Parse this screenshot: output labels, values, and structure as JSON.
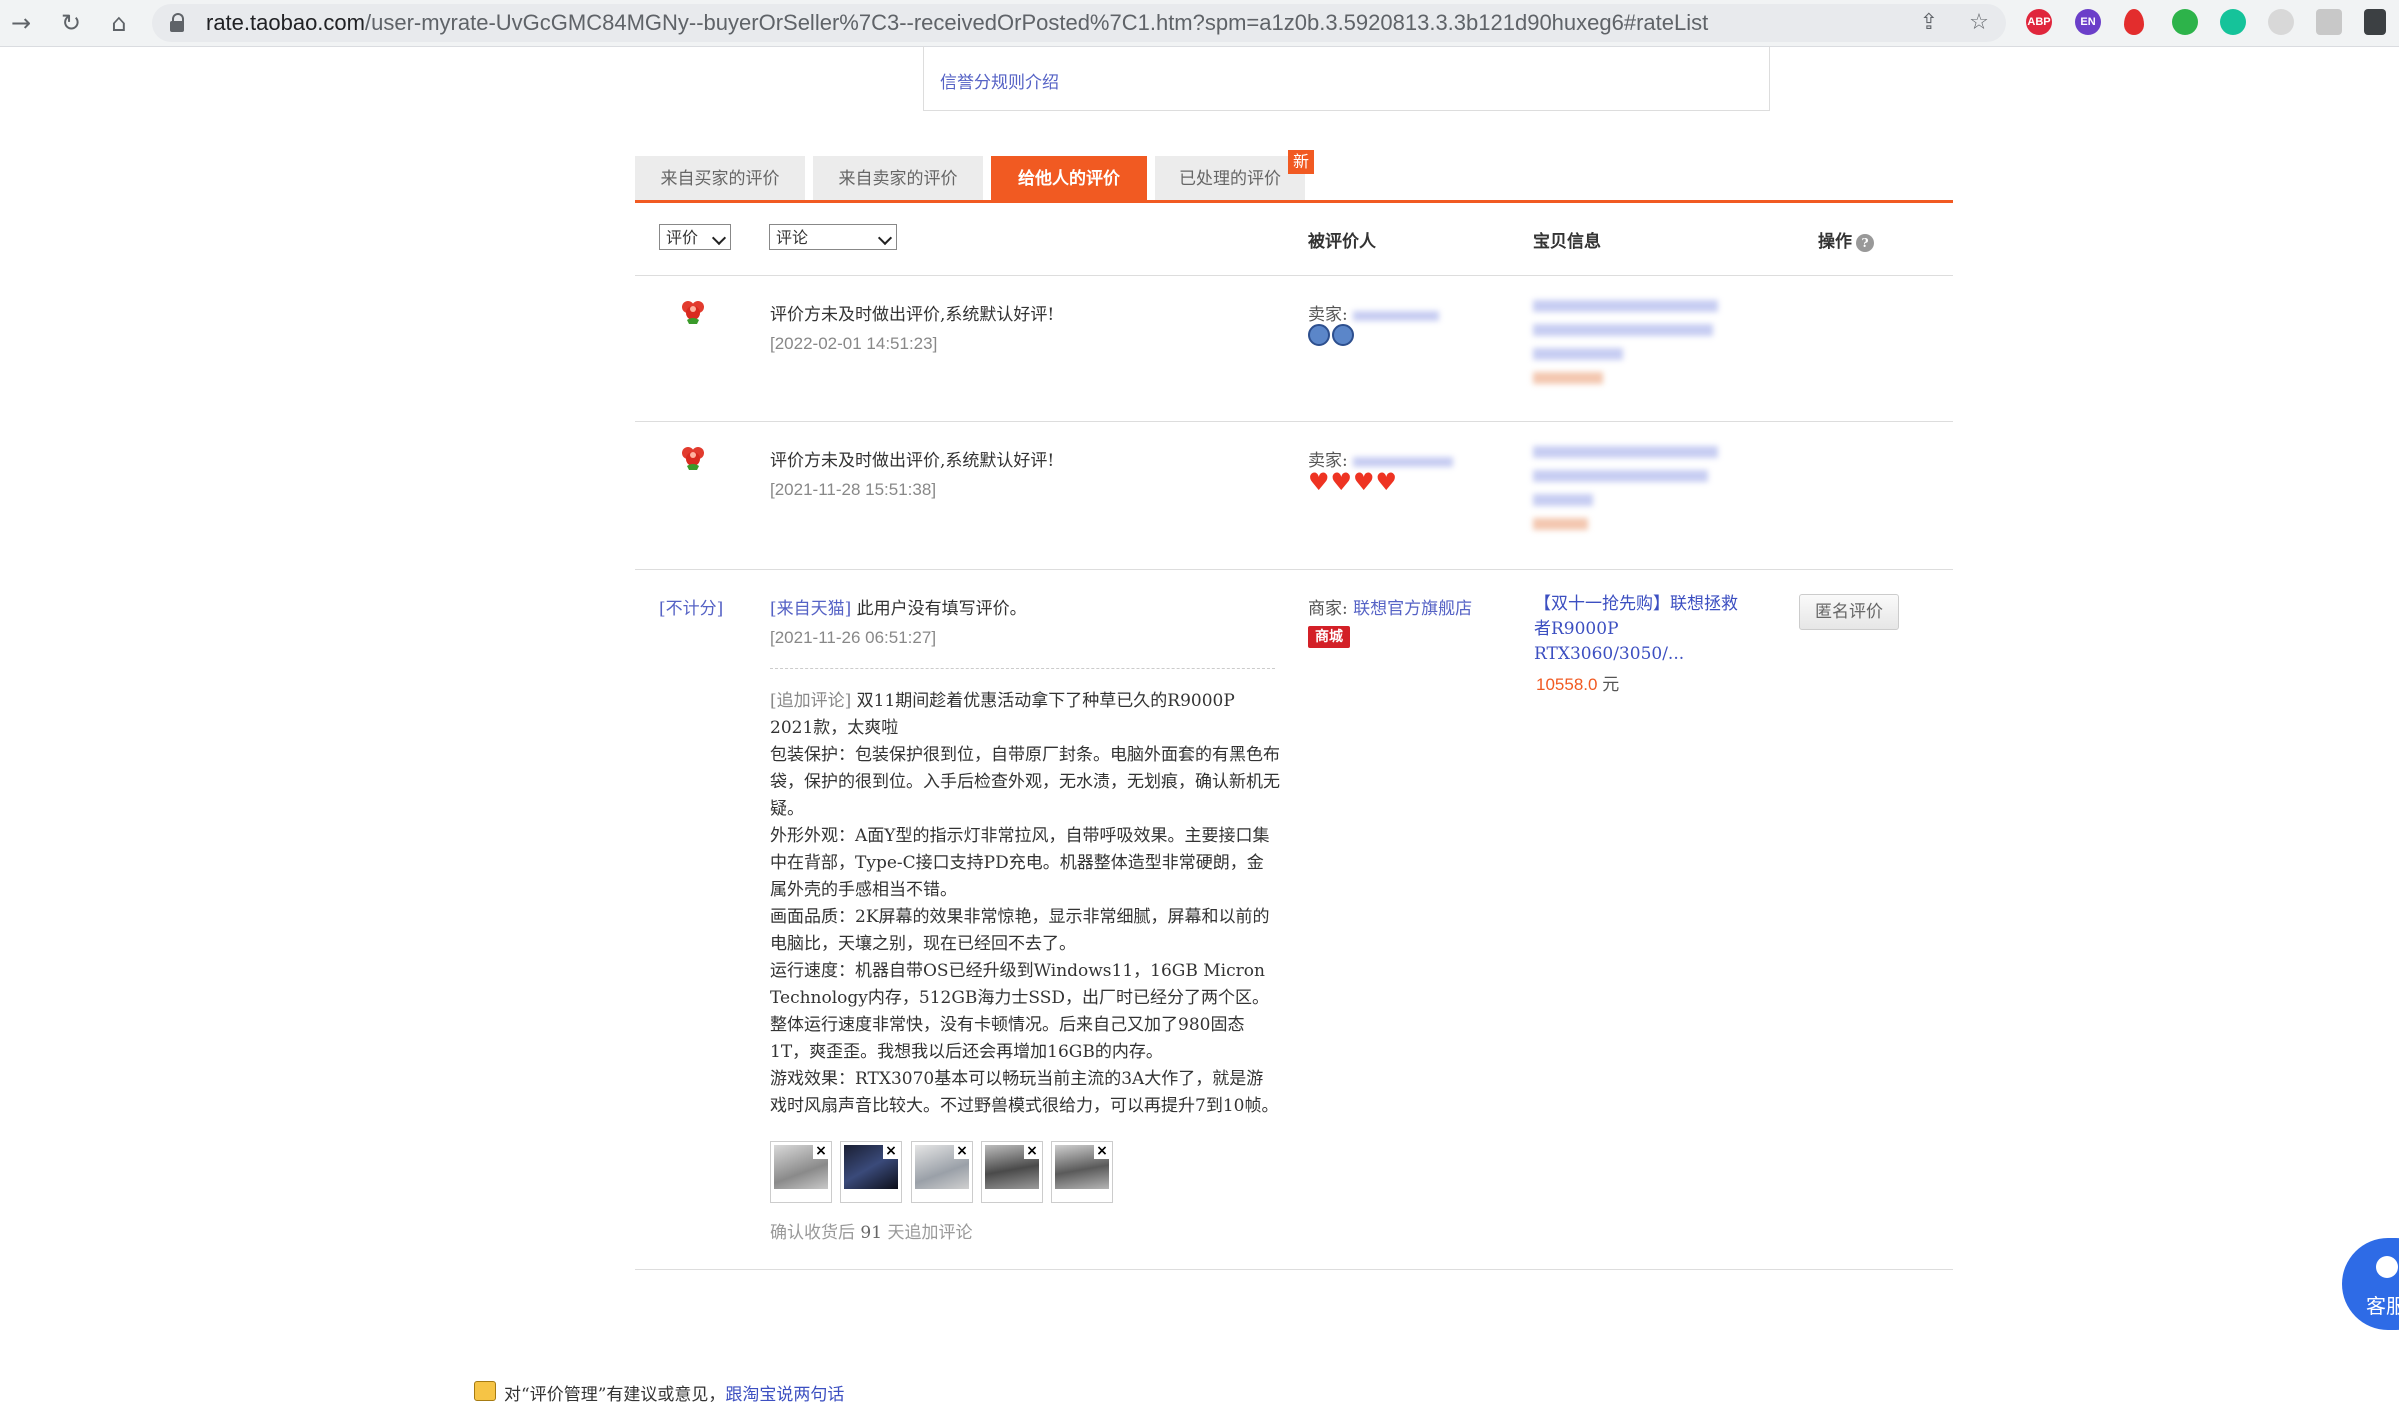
{
  "browser": {
    "url_domain": "rate.taobao.com",
    "url_path": "/user-myrate-UvGcGMC84MGNy--buyerOrSeller%7C3--receivedOrPosted%7C1.htm?spm=a1z0b.3.5920813.3.3b121d90huxeg6#rateList",
    "extensions": [
      "ABP",
      "EN"
    ]
  },
  "rules_link": "信誉分规则介绍",
  "tabs": [
    {
      "label": "来自买家的评价",
      "active": false
    },
    {
      "label": "来自卖家的评价",
      "active": false
    },
    {
      "label": "给他人的评价",
      "active": true
    },
    {
      "label": "已处理的评价",
      "active": false
    }
  ],
  "new_badge": "新",
  "table_header": {
    "rating_filter": "评价",
    "comment_filter": "评论",
    "col_reviewee": "被评价人",
    "col_item": "宝贝信息",
    "col_action": "操作",
    "help": "?"
  },
  "rows": [
    {
      "rating_icon": "flower-icon",
      "comment": "评价方未及时做出评价,系统默认好评!",
      "date": "[2022-02-01 14:51:23]",
      "seller_prefix": "卖家:",
      "seller_badge": "crown-icon"
    },
    {
      "rating_icon": "flower-icon",
      "comment": "评价方未及时做出评价,系统默认好评!",
      "date": "[2021-11-28 15:51:38]",
      "seller_prefix": "卖家:",
      "seller_badge": "heart-icon"
    },
    {
      "rating_label": "[不计分]",
      "source_tag": "[来自天猫]",
      "comment": "此用户没有填写评价。",
      "date": "[2021-11-26 06:51:27]",
      "seller_prefix": "商家:",
      "seller_name": "联想官方旗舰店",
      "tmall_badge": "商城",
      "item_title": "【双十一抢先购】联想拯救者R9000P RTX3060/3050/...",
      "price": "10558.0",
      "price_unit": "元",
      "action_button": "匿名评价",
      "append_tag": "[追加评论]",
      "append_paragraphs": [
        "双11期间趁着优惠活动拿下了种草已久的R9000P 2021款，太爽啦",
        "包装保护：包装保护很到位，自带原厂封条。电脑外面套的有黑色布袋，保护的很到位。入手后检查外观，无水渍，无划痕，确认新机无疑。",
        "外形外观：A面Y型的指示灯非常拉风，自带呼吸效果。主要接口集中在背部，Type-C接口支持PD充电。机器整体造型非常硬朗，金属外壳的手感相当不错。",
        "画面品质：2K屏幕的效果非常惊艳，显示非常细腻，屏幕和以前的电脑比，天壤之别，现在已经回不去了。",
        "运行速度：机器自带OS已经升级到Windows11，16GB Micron Technology内存，512GB海力士SSD，出厂时已经分了两个区。整体运行速度非常快，没有卡顿情况。后来自己又加了980固态1T，爽歪歪。我想我以后还会再增加16GB的内存。",
        "游戏效果：RTX3070基本可以畅玩当前主流的3A大作了，就是游戏时风扇声音比较大。不过野兽模式很给力，可以再提升7到10帧。"
      ],
      "thumb_close": "×",
      "confirm_prefix": "确认收货后 ",
      "confirm_days": "91",
      "confirm_suffix": " 天追加评论"
    }
  ],
  "feedback": {
    "text": "对“评价管理”有建议或意见，",
    "link": "跟淘宝说两句话"
  },
  "customer_service": "客服"
}
